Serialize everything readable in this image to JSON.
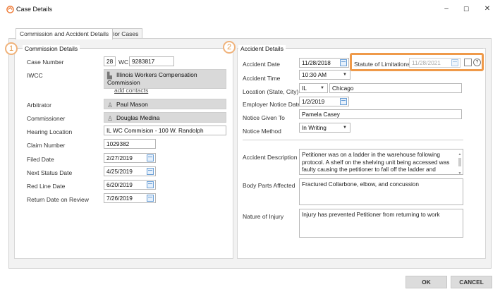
{
  "window": {
    "title": "Case Details",
    "minimize": "–",
    "maximize": "☐",
    "close": "✕"
  },
  "tabs": [
    "Commission and Accident Details",
    "Prior Cases"
  ],
  "markers": {
    "one": "1",
    "two": "2"
  },
  "commission": {
    "legend": "Commission Details",
    "case_number_label": "Case Number",
    "case_prefix": "28",
    "case_type": "WC",
    "case_number": "9283817",
    "iwcc_label": "IWCC",
    "iwcc_name": "Illinois Workers Compensation Commission",
    "add_contacts": "add contacts",
    "arbitrator_label": "Arbitrator",
    "arbitrator": "Paul Mason",
    "commissioner_label": "Commissioner",
    "commissioner": "Douglas Medina",
    "hearing_location_label": "Hearing Location",
    "hearing_location": "IL WC Commision - 100 W. Randolph",
    "claim_number_label": "Claim Number",
    "claim_number": "1029382",
    "filed_date_label": "Filed Date",
    "filed_date": "2/27/2019",
    "next_status_label": "Next Status Date",
    "next_status": "4/25/2019",
    "red_line_label": "Red Line Date",
    "red_line": "6/20/2019",
    "return_date_label": "Return Date on Review",
    "return_date": "7/26/2019"
  },
  "accident": {
    "legend": "Accident Details",
    "date_label": "Accident Date",
    "date": "11/28/2018",
    "sol_label": "Statute of Limitations",
    "sol_date": "11/28/2021",
    "time_label": "Accident Time",
    "time": "10:30 AM",
    "location_label": "Location (State, City)",
    "state": "IL",
    "city": "Chicago",
    "employer_notice_label": "Employer Notice Date",
    "employer_notice": "1/2/2019",
    "notice_given_label": "Notice Given To",
    "notice_given": "Pamela Casey",
    "notice_method_label": "Notice Method",
    "notice_method": "In Writing",
    "description_label": "Accident Description",
    "description": "Petitioner was on a ladder in the warehouse following protocol. A shelf on the shelving unit being accessed was faulty causing the petitioner to fall off the ladder and materials in the shelving",
    "body_parts_label": "Body Parts Affected",
    "body_parts": "Fractured Collarbone, elbow, and concussion",
    "injury_label": "Nature of Injury",
    "injury": "Injury has prevented Petitioner from returning to work"
  },
  "buttons": {
    "ok": "OK",
    "cancel": "CANCEL"
  },
  "colors": {
    "highlight": "#ef9a4a",
    "calendar_accent": "#6a9fd6"
  }
}
